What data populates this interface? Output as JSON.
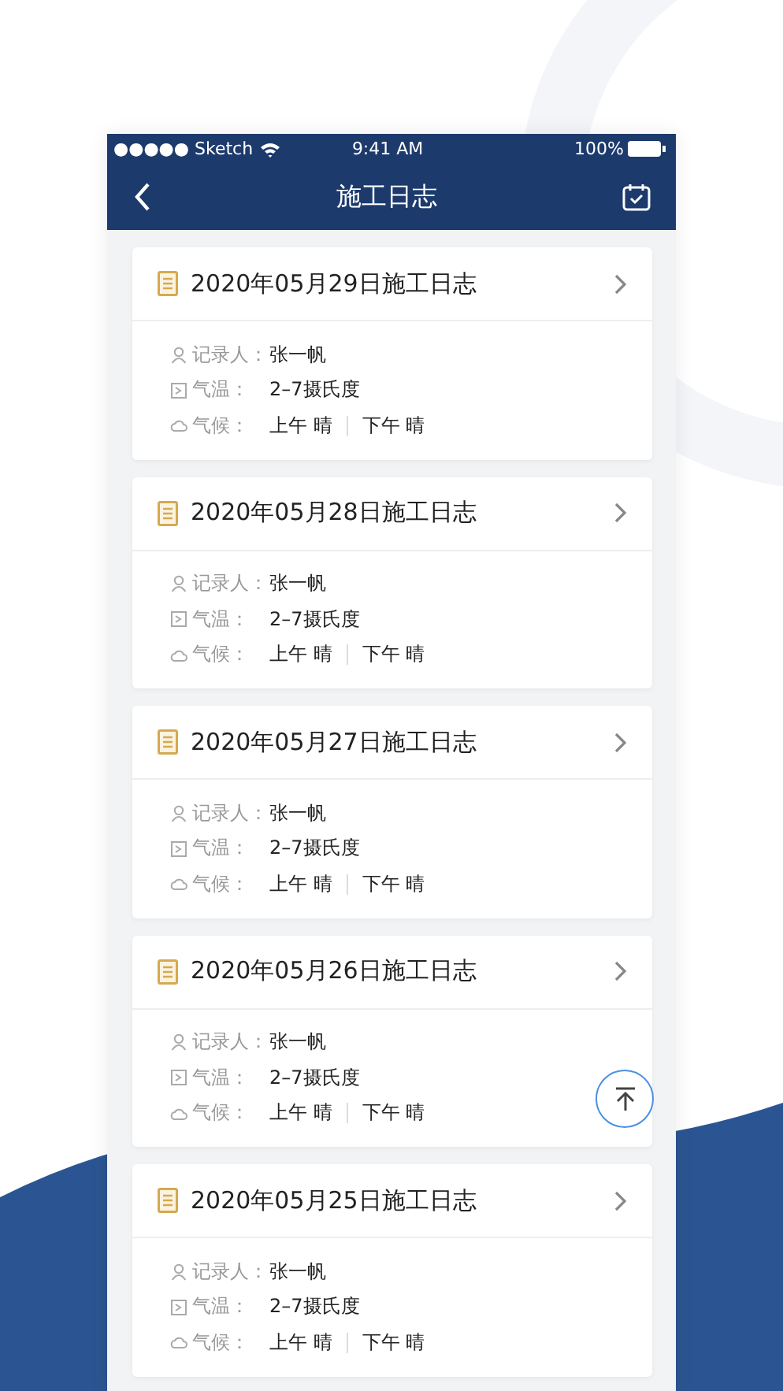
{
  "status_bar": {
    "carrier": "●●●●● Sketch",
    "time": "9:41 AM",
    "battery": "100%"
  },
  "nav": {
    "title": "施工日志"
  },
  "logs": [
    {
      "title": "2020年05月29日施工日志",
      "recorder_label": "记录人：",
      "recorder": "张一帆",
      "temp_label": "气温：",
      "temp": "2–7摄氏度",
      "weather_label": "气候：",
      "morning": "上午 晴",
      "afternoon": "下午 晴"
    },
    {
      "title": "2020年05月28日施工日志",
      "recorder_label": "记录人：",
      "recorder": "张一帆",
      "temp_label": "气温：",
      "temp": "2–7摄氏度",
      "weather_label": "气候：",
      "morning": "上午 晴",
      "afternoon": "下午 晴"
    },
    {
      "title": "2020年05月27日施工日志",
      "recorder_label": "记录人：",
      "recorder": "张一帆",
      "temp_label": "气温：",
      "temp": "2–7摄氏度",
      "weather_label": "气候：",
      "morning": "上午 晴",
      "afternoon": "下午 晴"
    },
    {
      "title": "2020年05月26日施工日志",
      "recorder_label": "记录人：",
      "recorder": "张一帆",
      "temp_label": "气温：",
      "temp": "2–7摄氏度",
      "weather_label": "气候：",
      "morning": "上午 晴",
      "afternoon": "下午 晴"
    },
    {
      "title": "2020年05月25日施工日志",
      "recorder_label": "记录人：",
      "recorder": "张一帆",
      "temp_label": "气温：",
      "temp": "2–7摄氏度",
      "weather_label": "气候：",
      "morning": "上午 晴",
      "afternoon": "下午 晴"
    }
  ]
}
